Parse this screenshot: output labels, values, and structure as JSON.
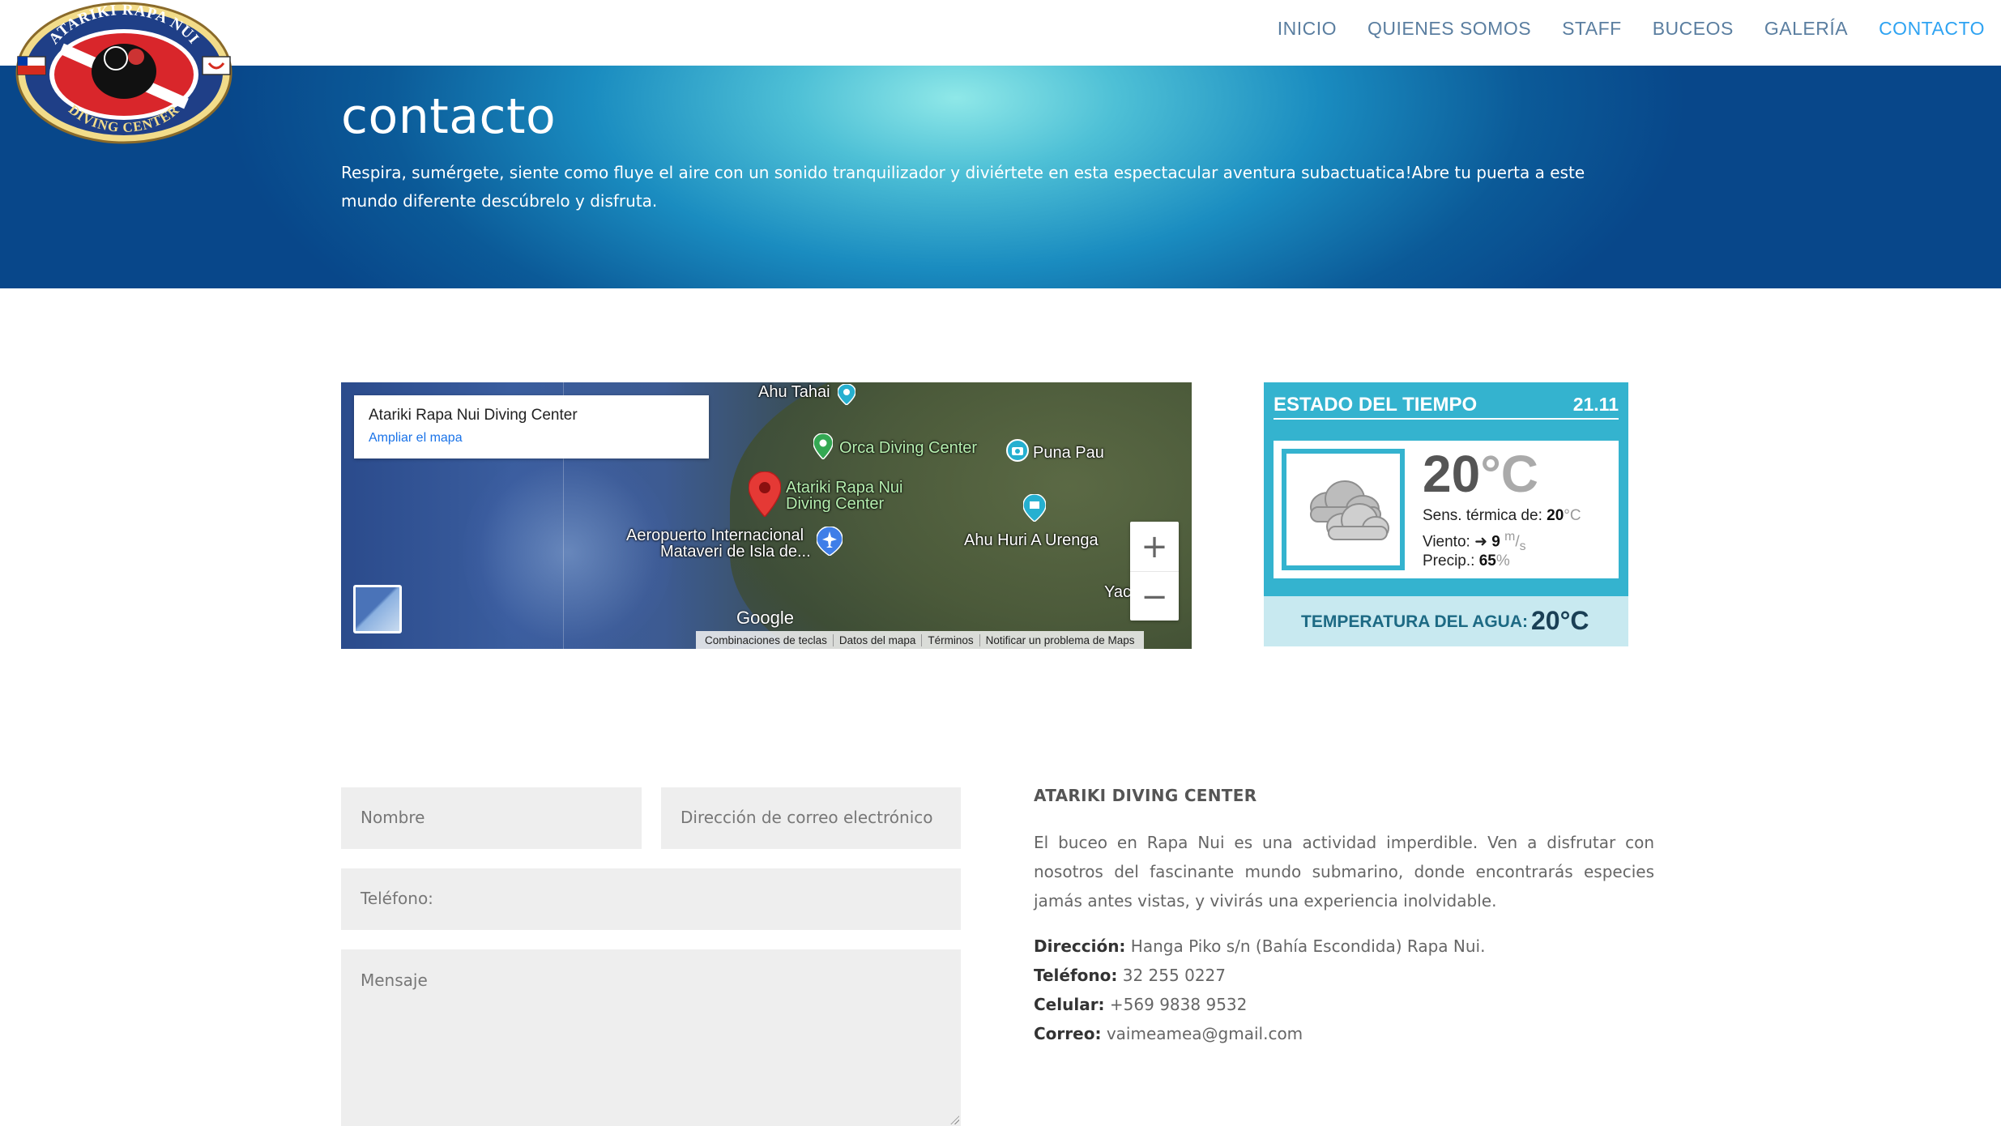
{
  "brand": {
    "logo_top_text": "ATARIKI RAPA NUI",
    "logo_bottom_text": "DIVING CENTER"
  },
  "nav": {
    "items": [
      "INICIO",
      "QUIENES SOMOS",
      "STAFF",
      "BUCEOS",
      "GALERÍA",
      "CONTACTO"
    ],
    "active": "CONTACTO"
  },
  "hero": {
    "title": "contacto",
    "text": "Respira, sumérgete, siente como fluye el aire con un sonido tranquilizador y diviértete en esta espectacular aventura subactuatica!Abre tu puerta a este mundo diferente descúbrelo y disfruta."
  },
  "map": {
    "card_title": "Atariki Rapa Nui Diving Center",
    "card_link": "Ampliar el mapa",
    "labels": {
      "ahu_tahai": "Ahu Tahai",
      "orca": "Orca Diving Center",
      "puna_pau": "Puna Pau",
      "atariki_1": "Atariki Rapa Nui",
      "atariki_2": "Diving Center",
      "airport_1": "Aeropuerto Internacional",
      "airport_2": "Mataveri de Isla de...",
      "ahu_huri": "Ahu Huri A Urenga",
      "yac": "Yac",
      "google": "Google"
    },
    "footer": [
      "Combinaciones de teclas",
      "Datos del mapa",
      "Términos",
      "Notificar un problema de Maps"
    ],
    "zoom_in": "+",
    "zoom_out": "−"
  },
  "weather": {
    "title": "ESTADO DEL TIEMPO",
    "date": "21.11",
    "icon": "cloud-icon",
    "temp_value": "20",
    "temp_unit": "°C",
    "feels_label": "Sens. térmica de:",
    "feels_value": "20",
    "feels_unit": "°C",
    "wind_label": "Viento:",
    "wind_value": "9",
    "wind_unit_top": "m",
    "wind_unit_bottom": "s",
    "precip_label": "Precip.:",
    "precip_value": "65",
    "precip_unit": "%",
    "water_label": "TEMPERATURA DEL AGUA:",
    "water_value": "20°C",
    "accent": "#34b3cf"
  },
  "form": {
    "name_placeholder": "Nombre",
    "email_placeholder": "Dirección de correo electrónico",
    "phone_placeholder": "Teléfono:",
    "message_placeholder": "Mensaje"
  },
  "info": {
    "title": "ATARIKI DIVING CENTER",
    "description": "El buceo en Rapa Nui es una actividad imperdible. Ven a disfrutar con nosotros del fascinante mundo submarino, donde encontrarás especies jamás antes vistas, y vivirás una experiencia inolvidable.",
    "address_label": "Dirección:",
    "address": "Hanga Piko s/n (Bahía Escondida) Rapa Nui.",
    "phone_label": "Teléfono:",
    "phone": "32 255 0227",
    "mobile_label": "Celular:",
    "mobile": "+569 9838 9532",
    "email_label": "Correo:",
    "email": "vaimeamea@gmail.com"
  },
  "colors": {
    "nav_link": "#5a7ea0",
    "nav_active": "#2ea3f2",
    "hero_dark": "#08478a",
    "hero_light": "#8fe8e8"
  }
}
